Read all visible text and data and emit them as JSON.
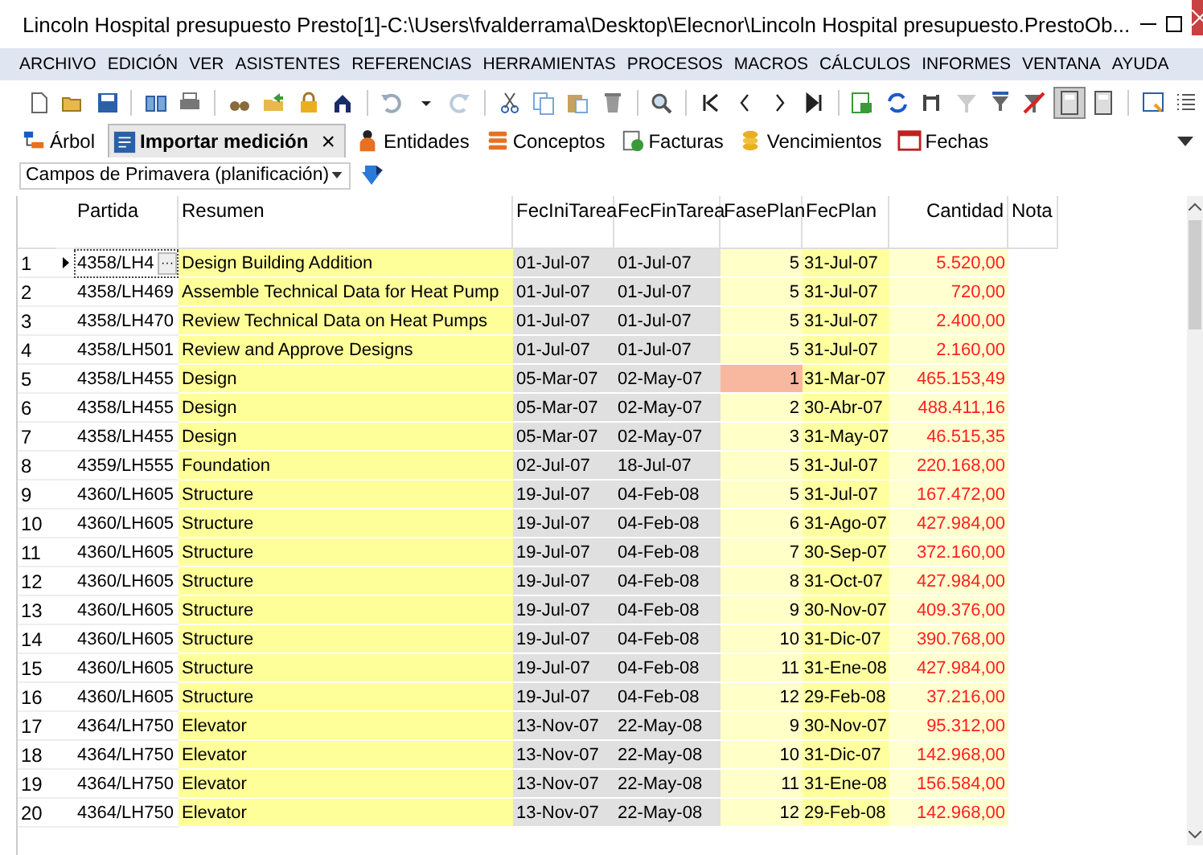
{
  "window": {
    "title": "Lincoln Hospital presupuesto Presto[1]-C:\\Users\\fvalderrama\\Desktop\\Elecnor\\Lincoln Hospital presupuesto.PrestoOb..."
  },
  "menu": [
    "ARCHIVO",
    "EDICIÓN",
    "VER",
    "ASISTENTES",
    "REFERENCIAS",
    "HERRAMIENTAS",
    "PROCESOS",
    "MACROS",
    "CÁLCULOS",
    "INFORMES",
    "VENTANA",
    "AYUDA"
  ],
  "toolbar": [
    {
      "kind": "new"
    },
    {
      "kind": "open"
    },
    {
      "kind": "save"
    },
    {
      "kind": "sep"
    },
    {
      "kind": "book"
    },
    {
      "kind": "print"
    },
    {
      "kind": "sep"
    },
    {
      "kind": "binoculars"
    },
    {
      "kind": "export"
    },
    {
      "kind": "lock"
    },
    {
      "kind": "home"
    },
    {
      "kind": "sep"
    },
    {
      "kind": "undo"
    },
    {
      "kind": "caret"
    },
    {
      "kind": "redo"
    },
    {
      "kind": "sep"
    },
    {
      "kind": "cut"
    },
    {
      "kind": "copy"
    },
    {
      "kind": "paste"
    },
    {
      "kind": "trash"
    },
    {
      "kind": "sep"
    },
    {
      "kind": "search"
    },
    {
      "kind": "sep"
    },
    {
      "kind": "first"
    },
    {
      "kind": "prev"
    },
    {
      "kind": "next"
    },
    {
      "kind": "last"
    },
    {
      "kind": "sep"
    },
    {
      "kind": "sheet"
    },
    {
      "kind": "refresh"
    },
    {
      "kind": "tools"
    },
    {
      "kind": "filter"
    },
    {
      "kind": "spell"
    },
    {
      "kind": "nofilter"
    },
    {
      "kind": "calc",
      "pressed": true
    },
    {
      "kind": "calc",
      "pressed": false
    },
    {
      "kind": "sep"
    },
    {
      "kind": "window"
    },
    {
      "kind": "list"
    }
  ],
  "tabs": [
    {
      "label": "Árbol",
      "selected": false,
      "closable": false
    },
    {
      "label": "Importar medición",
      "selected": true,
      "closable": true
    },
    {
      "label": "Entidades",
      "selected": false,
      "closable": false
    },
    {
      "label": "Conceptos",
      "selected": false,
      "closable": false
    },
    {
      "label": "Facturas",
      "selected": false,
      "closable": false
    },
    {
      "label": "Vencimientos",
      "selected": false,
      "closable": false
    },
    {
      "label": "Fechas",
      "selected": false,
      "closable": false
    }
  ],
  "tab_close_glyph": "×",
  "filter": {
    "value": "Campos de Primavera (planificación)"
  },
  "table": {
    "columns": [
      "Partida",
      "Resumen",
      "FecIniTarea",
      "FecFinTarea",
      "FasePlan",
      "FecPlan",
      "Cantidad",
      "Nota"
    ],
    "ellipsis": "···",
    "rows": [
      {
        "num": "1",
        "partida": "4358/LH4",
        "resumen": "Design Building Addition",
        "ini": "01-Jul-07",
        "fin": "01-Jul-07",
        "fase": "5",
        "plan": "31-Jul-07",
        "cantidad": "5.520,00",
        "current": true,
        "flagged": false
      },
      {
        "num": "2",
        "partida": "4358/LH469",
        "resumen": "Assemble Technical Data for Heat Pump",
        "ini": "01-Jul-07",
        "fin": "01-Jul-07",
        "fase": "5",
        "plan": "31-Jul-07",
        "cantidad": "720,00",
        "current": false,
        "flagged": false
      },
      {
        "num": "3",
        "partida": "4358/LH470",
        "resumen": "Review Technical Data on Heat Pumps",
        "ini": "01-Jul-07",
        "fin": "01-Jul-07",
        "fase": "5",
        "plan": "31-Jul-07",
        "cantidad": "2.400,00",
        "current": false,
        "flagged": false
      },
      {
        "num": "4",
        "partida": "4358/LH501",
        "resumen": "Review and Approve Designs",
        "ini": "01-Jul-07",
        "fin": "01-Jul-07",
        "fase": "5",
        "plan": "31-Jul-07",
        "cantidad": "2.160,00",
        "current": false,
        "flagged": false
      },
      {
        "num": "5",
        "partida": "4358/LH455",
        "resumen": "Design",
        "ini": "05-Mar-07",
        "fin": "02-May-07",
        "fase": "1",
        "plan": "31-Mar-07",
        "cantidad": "465.153,49",
        "current": false,
        "flagged": true
      },
      {
        "num": "6",
        "partida": "4358/LH455",
        "resumen": "Design",
        "ini": "05-Mar-07",
        "fin": "02-May-07",
        "fase": "2",
        "plan": "30-Abr-07",
        "cantidad": "488.411,16",
        "current": false,
        "flagged": false
      },
      {
        "num": "7",
        "partida": "4358/LH455",
        "resumen": "Design",
        "ini": "05-Mar-07",
        "fin": "02-May-07",
        "fase": "3",
        "plan": "31-May-07",
        "cantidad": "46.515,35",
        "current": false,
        "flagged": false
      },
      {
        "num": "8",
        "partida": "4359/LH555",
        "resumen": "Foundation",
        "ini": "02-Jul-07",
        "fin": "18-Jul-07",
        "fase": "5",
        "plan": "31-Jul-07",
        "cantidad": "220.168,00",
        "current": false,
        "flagged": false
      },
      {
        "num": "9",
        "partida": "4360/LH605",
        "resumen": "Structure",
        "ini": "19-Jul-07",
        "fin": "04-Feb-08",
        "fase": "5",
        "plan": "31-Jul-07",
        "cantidad": "167.472,00",
        "current": false,
        "flagged": false
      },
      {
        "num": "10",
        "partida": "4360/LH605",
        "resumen": "Structure",
        "ini": "19-Jul-07",
        "fin": "04-Feb-08",
        "fase": "6",
        "plan": "31-Ago-07",
        "cantidad": "427.984,00",
        "current": false,
        "flagged": false
      },
      {
        "num": "11",
        "partida": "4360/LH605",
        "resumen": "Structure",
        "ini": "19-Jul-07",
        "fin": "04-Feb-08",
        "fase": "7",
        "plan": "30-Sep-07",
        "cantidad": "372.160,00",
        "current": false,
        "flagged": false
      },
      {
        "num": "12",
        "partida": "4360/LH605",
        "resumen": "Structure",
        "ini": "19-Jul-07",
        "fin": "04-Feb-08",
        "fase": "8",
        "plan": "31-Oct-07",
        "cantidad": "427.984,00",
        "current": false,
        "flagged": false
      },
      {
        "num": "13",
        "partida": "4360/LH605",
        "resumen": "Structure",
        "ini": "19-Jul-07",
        "fin": "04-Feb-08",
        "fase": "9",
        "plan": "30-Nov-07",
        "cantidad": "409.376,00",
        "current": false,
        "flagged": false
      },
      {
        "num": "14",
        "partida": "4360/LH605",
        "resumen": "Structure",
        "ini": "19-Jul-07",
        "fin": "04-Feb-08",
        "fase": "10",
        "plan": "31-Dic-07",
        "cantidad": "390.768,00",
        "current": false,
        "flagged": false
      },
      {
        "num": "15",
        "partida": "4360/LH605",
        "resumen": "Structure",
        "ini": "19-Jul-07",
        "fin": "04-Feb-08",
        "fase": "11",
        "plan": "31-Ene-08",
        "cantidad": "427.984,00",
        "current": false,
        "flagged": false
      },
      {
        "num": "16",
        "partida": "4360/LH605",
        "resumen": "Structure",
        "ini": "19-Jul-07",
        "fin": "04-Feb-08",
        "fase": "12",
        "plan": "29-Feb-08",
        "cantidad": "37.216,00",
        "current": false,
        "flagged": false
      },
      {
        "num": "17",
        "partida": "4364/LH750",
        "resumen": "Elevator",
        "ini": "13-Nov-07",
        "fin": "22-May-08",
        "fase": "9",
        "plan": "30-Nov-07",
        "cantidad": "95.312,00",
        "current": false,
        "flagged": false
      },
      {
        "num": "18",
        "partida": "4364/LH750",
        "resumen": "Elevator",
        "ini": "13-Nov-07",
        "fin": "22-May-08",
        "fase": "10",
        "plan": "31-Dic-07",
        "cantidad": "142.968,00",
        "current": false,
        "flagged": false
      },
      {
        "num": "19",
        "partida": "4364/LH750",
        "resumen": "Elevator",
        "ini": "13-Nov-07",
        "fin": "22-May-08",
        "fase": "11",
        "plan": "31-Ene-08",
        "cantidad": "156.584,00",
        "current": false,
        "flagged": false
      },
      {
        "num": "20",
        "partida": "4364/LH750",
        "resumen": "Elevator",
        "ini": "13-Nov-07",
        "fin": "22-May-08",
        "fase": "12",
        "plan": "29-Feb-08",
        "cantidad": "142.968,00",
        "current": false,
        "flagged": false
      }
    ]
  }
}
